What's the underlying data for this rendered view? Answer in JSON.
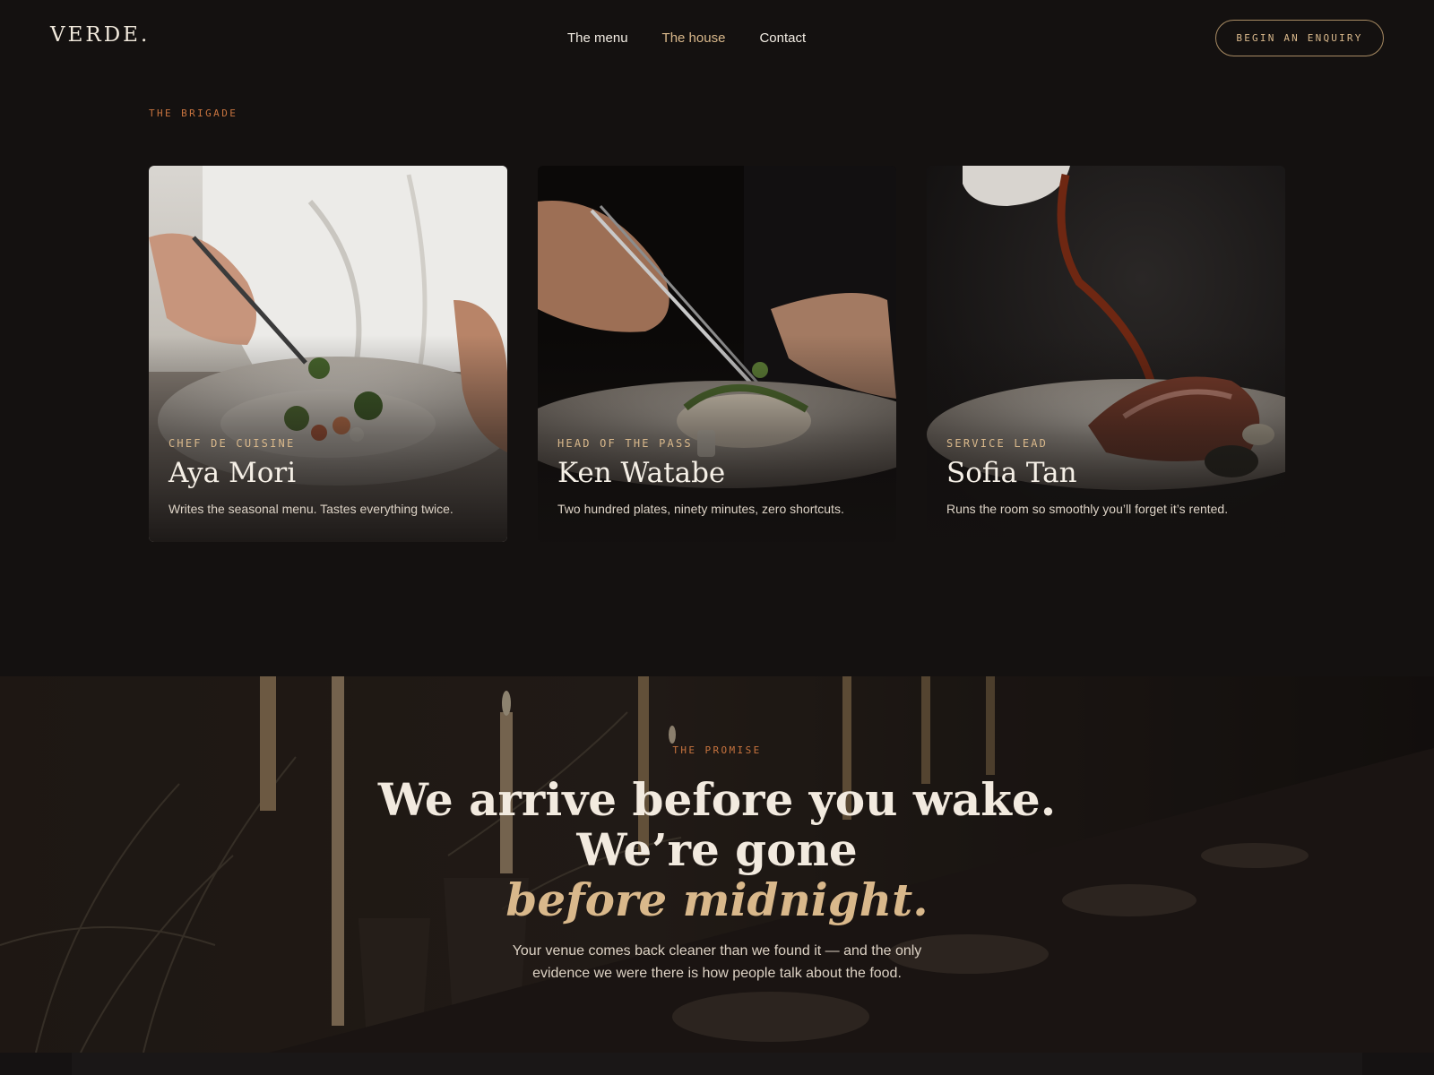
{
  "header": {
    "brand": "VERDE.",
    "nav": [
      {
        "label": "The menu",
        "active": false
      },
      {
        "label": "The house",
        "active": true
      },
      {
        "label": "Contact",
        "active": false
      }
    ],
    "cta_label": "BEGIN AN ENQUIRY"
  },
  "brigade": {
    "eyebrow": "THE BRIGADE",
    "cards": [
      {
        "role": "CHEF DE CUISINE",
        "name": "Aya Mori",
        "description": "Writes the seasonal menu. Tastes everything twice."
      },
      {
        "role": "HEAD OF THE PASS",
        "name": "Ken Watabe",
        "description": "Two hundred plates, ninety minutes, zero shortcuts."
      },
      {
        "role": "SERVICE LEAD",
        "name": "Sofia Tan",
        "description": "Runs the room so smoothly you’ll forget it’s rented."
      }
    ]
  },
  "promise": {
    "eyebrow": "THE PROMISE",
    "headline_line1": "We arrive before you wake. We’re gone",
    "headline_accent": "before midnight.",
    "body": "Your venue comes back cleaner than we found it — and the only evidence we were there is how people talk about the food."
  },
  "colors": {
    "background": "#141110",
    "accent_gold": "#d9b88b",
    "eyebrow_orange": "#c8743f",
    "text_light": "#f2eadf"
  }
}
